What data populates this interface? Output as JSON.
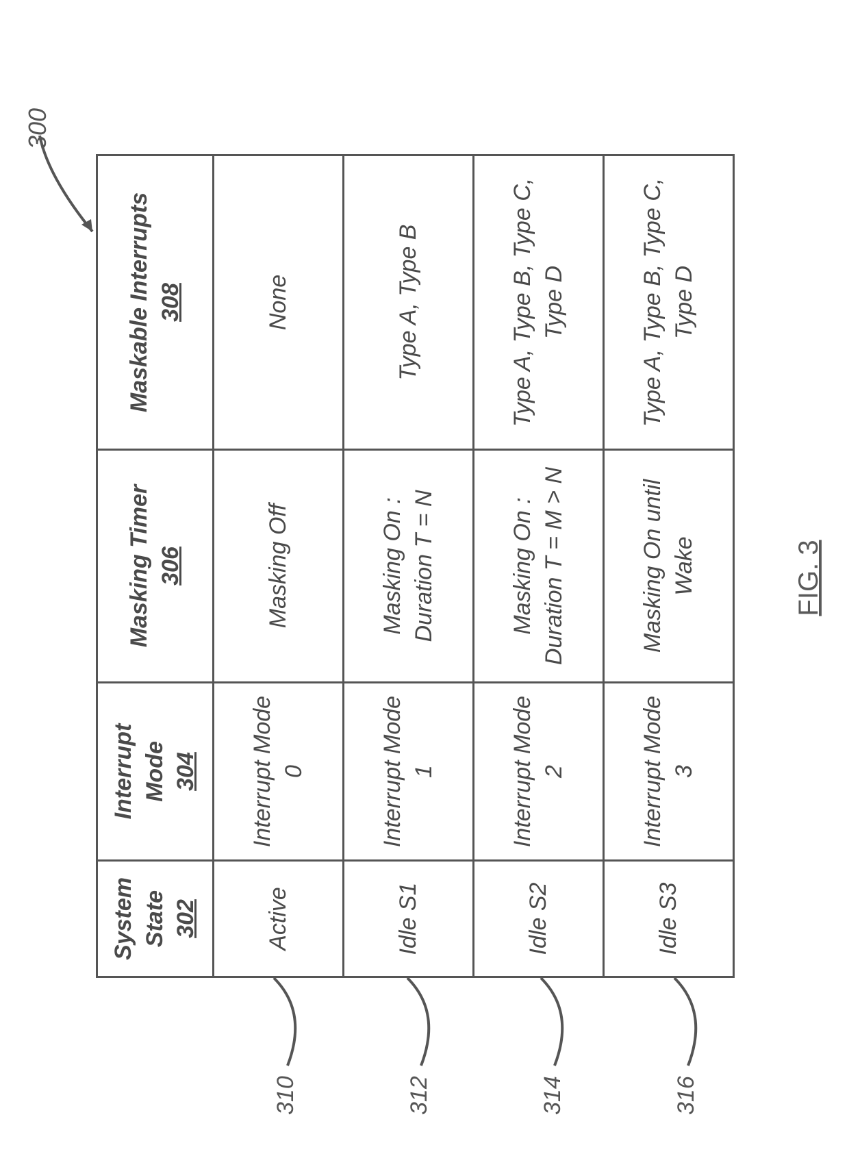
{
  "figure_ref_label": "300",
  "figure_caption": "FIG. 3",
  "columns": [
    {
      "title": "System State",
      "ref": "302"
    },
    {
      "title": "Interrupt Mode",
      "ref": "304"
    },
    {
      "title": "Masking Timer",
      "ref": "306"
    },
    {
      "title": "Maskable Interrupts",
      "ref": "308"
    }
  ],
  "rows": [
    {
      "ref": "310",
      "system_state": "Active",
      "interrupt_mode": "Interrupt Mode 0",
      "masking_timer": "Masking Off",
      "maskable_interrupts": "None"
    },
    {
      "ref": "312",
      "system_state": "Idle S1",
      "interrupt_mode": "Interrupt Mode 1",
      "masking_timer": "Masking On : Duration T = N",
      "maskable_interrupts": "Type A, Type B"
    },
    {
      "ref": "314",
      "system_state": "Idle S2",
      "interrupt_mode": "Interrupt Mode 2",
      "masking_timer": "Masking On : Duration T = M > N",
      "maskable_interrupts": "Type A, Type B, Type C, Type D"
    },
    {
      "ref": "316",
      "system_state": "Idle S3",
      "interrupt_mode": "Interrupt Mode 3",
      "masking_timer": "Masking On until Wake",
      "maskable_interrupts": "Type A, Type B, Type C, Type D"
    }
  ]
}
